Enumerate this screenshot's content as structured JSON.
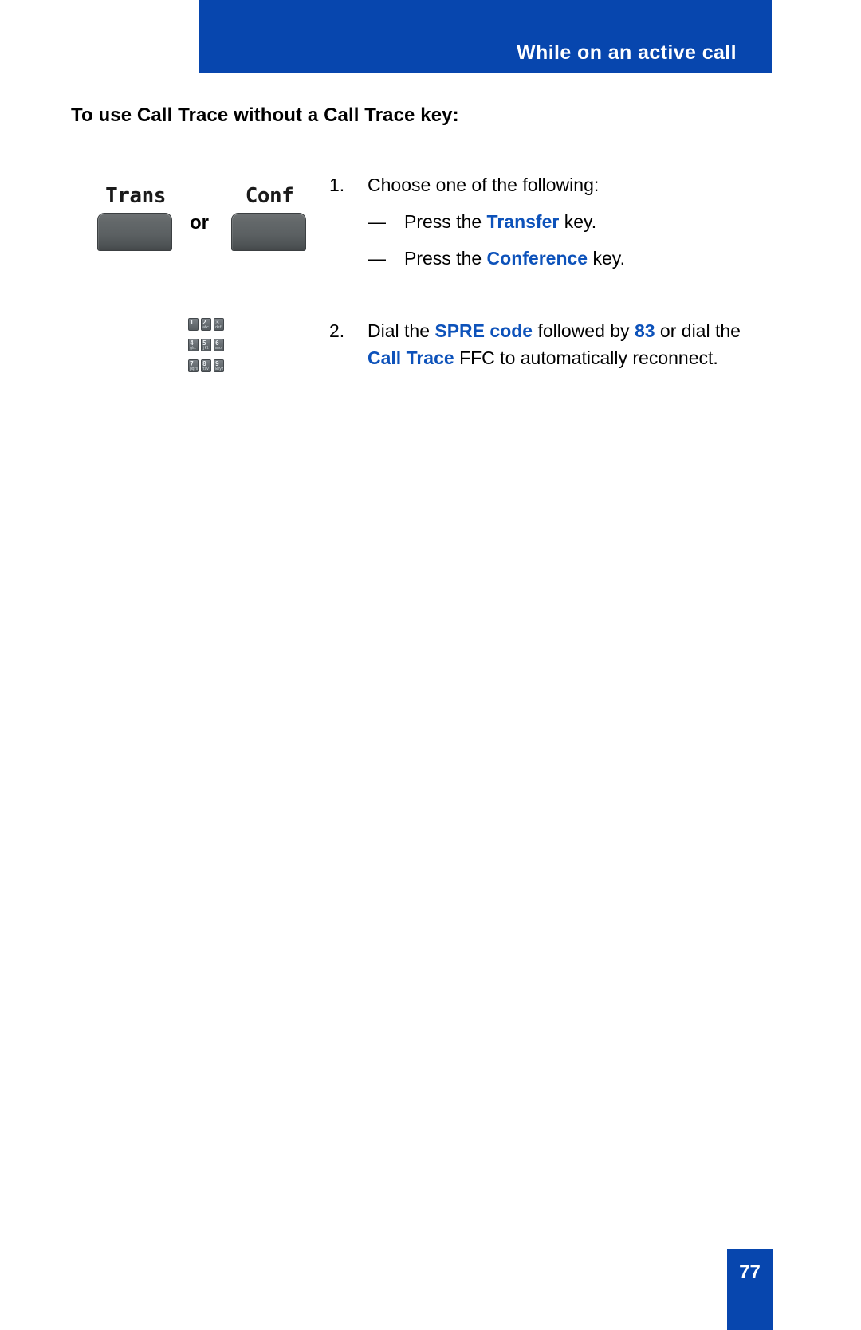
{
  "header": {
    "title": "While on an active call",
    "banner_color": "#0746ae"
  },
  "section": {
    "heading": "To use Call Trace without a Call Trace key:"
  },
  "illustration": {
    "trans_key_label": "Trans",
    "conf_key_label": "Conf",
    "or_label": "or",
    "keypad": {
      "keys": [
        {
          "digit": "1",
          "letters": ""
        },
        {
          "digit": "2",
          "letters": "abc"
        },
        {
          "digit": "3",
          "letters": "def"
        },
        {
          "digit": "4",
          "letters": "ghi"
        },
        {
          "digit": "5",
          "letters": "jkl"
        },
        {
          "digit": "6",
          "letters": "mno"
        },
        {
          "digit": "7",
          "letters": "pqrs"
        },
        {
          "digit": "8",
          "letters": "tuv"
        },
        {
          "digit": "9",
          "letters": "wxyz"
        }
      ]
    }
  },
  "steps": {
    "step1": {
      "number": "1.",
      "text": "Choose one of the following:",
      "sub_items": [
        {
          "dash": "—",
          "prefix": "Press the ",
          "emphasis": "Transfer",
          "suffix": " key."
        },
        {
          "dash": "—",
          "prefix": "Press the ",
          "emphasis": "Conference",
          "suffix": " key."
        }
      ]
    },
    "step2": {
      "number": "2.",
      "part1": "Dial the ",
      "emphasis1": "SPRE code",
      "part2": " followed by ",
      "emphasis2": "83",
      "part3": " or dial the ",
      "emphasis3": "Call Trace",
      "part4": " FFC to automatically reconnect."
    }
  },
  "footer": {
    "page_number": "77",
    "block_color": "#0746ae"
  },
  "colors": {
    "accent_blue": "#0746ae",
    "emphasis_blue": "#0d52ba",
    "text_black": "#000000"
  }
}
